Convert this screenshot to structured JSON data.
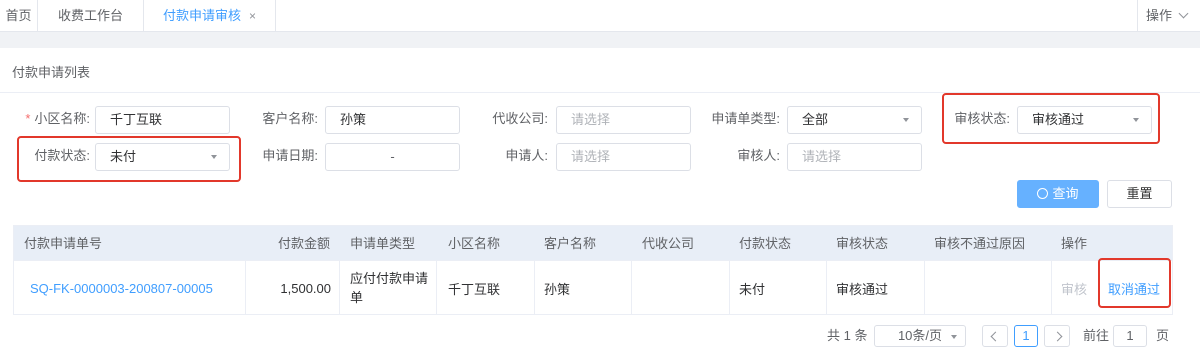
{
  "tabs": [
    {
      "label": "首页"
    },
    {
      "label": "收费工作台"
    },
    {
      "label": "付款申请审核",
      "close": "×"
    }
  ],
  "ops_label": "操作",
  "card_title": "付款申请列表",
  "form": {
    "community": {
      "label": "小区名称:",
      "required": "*",
      "value": "千丁互联"
    },
    "customer": {
      "label": "客户名称:",
      "value": "孙策"
    },
    "agent": {
      "label": "代收公司:",
      "placeholder": "请选择"
    },
    "apply_type": {
      "label": "申请单类型:",
      "value": "全部"
    },
    "audit_status": {
      "label": "审核状态:",
      "value": "审核通过"
    },
    "pay_status": {
      "label": "付款状态:",
      "value": "未付"
    },
    "apply_date": {
      "label": "申请日期:",
      "value": "-"
    },
    "applicant": {
      "label": "申请人:",
      "placeholder": "请选择"
    },
    "auditor": {
      "label": "审核人:",
      "placeholder": "请选择"
    }
  },
  "buttons": {
    "query": "查询",
    "reset": "重置"
  },
  "table": {
    "headers": [
      "付款申请单号",
      "付款金额",
      "申请单类型",
      "小区名称",
      "客户名称",
      "代收公司",
      "付款状态",
      "审核状态",
      "审核不通过原因",
      "操作"
    ],
    "rows": [
      {
        "no": "SQ-FK-0000003-200807-00005",
        "amount": "1,500.00",
        "type": "应付付款申请单",
        "community": "千丁互联",
        "customer": "孙策",
        "agent": "",
        "pay_status": "未付",
        "audit_status": "审核通过",
        "reject_reason": "",
        "action_audit": "审核",
        "action_cancel": "取消通过"
      }
    ]
  },
  "pagination": {
    "total": "共 1 条",
    "page_size": "10条/页",
    "current_page": "1",
    "goto_label": "前往",
    "goto_value": "1",
    "page_suffix": "页"
  },
  "colors": {
    "primary": "#409eff",
    "highlight": "#e2382b",
    "header_bg": "#e8eef7"
  }
}
